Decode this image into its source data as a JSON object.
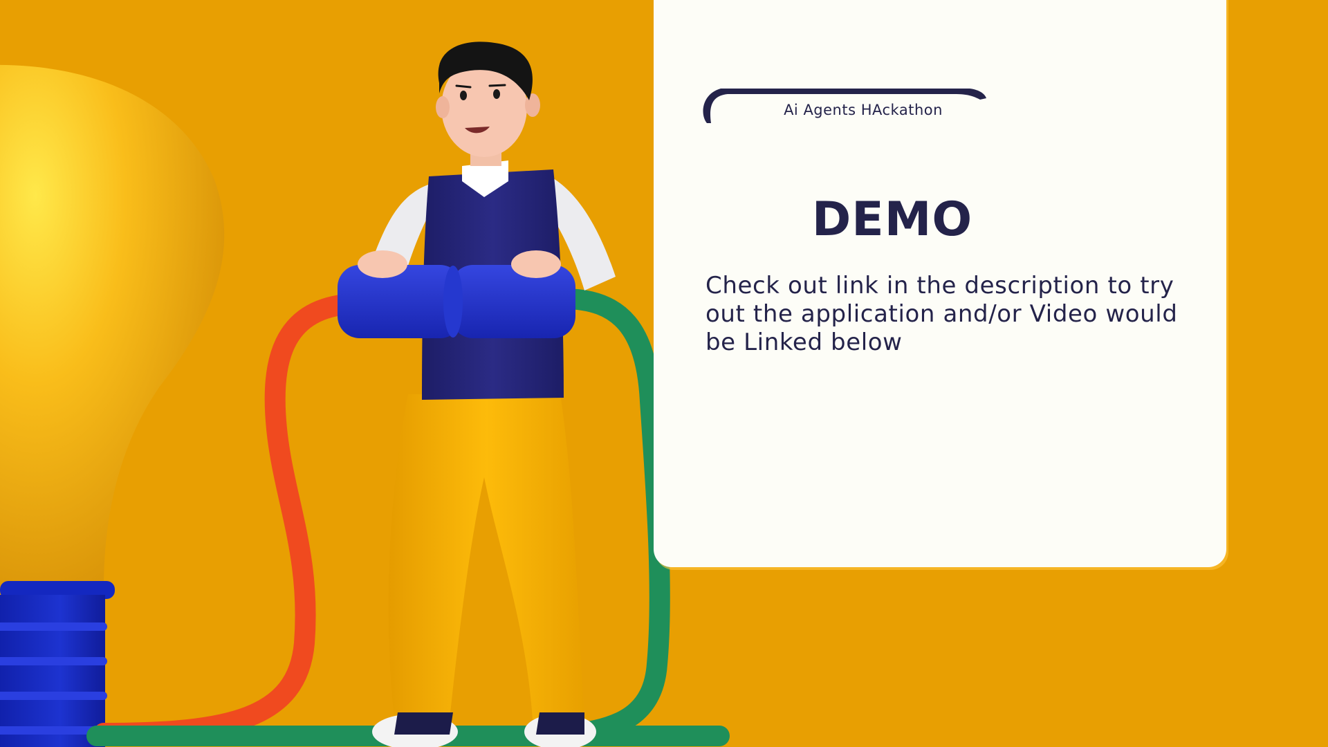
{
  "slide": {
    "tag_label": "Ai Agents HAckathon",
    "title": "DEMO",
    "body": "Check out link in the description to try out the application and/or Video would be Linked below"
  },
  "colors": {
    "background": "#e89f02",
    "card": "#fdfdf7",
    "text": "#24234a",
    "bulb": "#f5b510",
    "bulb_base": "#1a2ec9",
    "cable_red": "#f04a1f",
    "cable_green": "#1f8f5a",
    "vest": "#26267a",
    "pants": "#f7b405",
    "connector": "#2230c8"
  },
  "icons": [
    "light-bulb-illustration",
    "person-illustration",
    "plug-connector-illustration"
  ]
}
